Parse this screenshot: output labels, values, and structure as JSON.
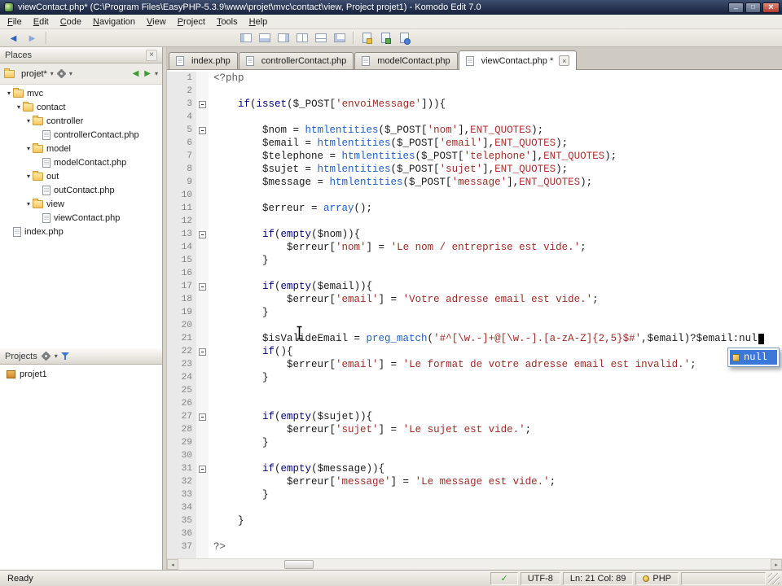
{
  "window": {
    "title": "viewContact.php* (C:\\Program Files\\EasyPHP-5.3.9\\www\\projet\\mvc\\contact\\view, Project projet1) - Komodo Edit 7.0"
  },
  "menubar": {
    "items": [
      "File",
      "Edit",
      "Code",
      "Navigation",
      "View",
      "Project",
      "Tools",
      "Help"
    ]
  },
  "toolbar": {
    "groups": [
      {
        "buttons": [
          {
            "name": "back-icon",
            "kind": "arrow-back"
          },
          {
            "name": "forward-icon",
            "kind": "arrow-forward"
          }
        ]
      },
      {
        "buttons": [
          {
            "name": "toggle-left-pane-icon",
            "kind": "pane-left"
          },
          {
            "name": "toggle-bottom-pane-icon",
            "kind": "pane-bottom"
          },
          {
            "name": "toggle-right-pane-icon",
            "kind": "pane-right"
          },
          {
            "name": "split-vertical-icon",
            "kind": "pane-vsplit"
          },
          {
            "name": "split-horizontal-icon",
            "kind": "pane-hsplit"
          },
          {
            "name": "show-all-panes-icon",
            "kind": "pane-all"
          }
        ]
      },
      {
        "buttons": [
          {
            "name": "open-file-icon",
            "kind": "doc-open"
          },
          {
            "name": "save-file-icon",
            "kind": "doc-save"
          },
          {
            "name": "preview-browser-icon",
            "kind": "doc-preview"
          }
        ]
      }
    ]
  },
  "places": {
    "title": "Places",
    "project_selector": "projet*",
    "tree": [
      {
        "label": "mvc",
        "type": "folder",
        "depth": 0
      },
      {
        "label": "contact",
        "type": "folder",
        "depth": 1
      },
      {
        "label": "controller",
        "type": "folder",
        "depth": 2
      },
      {
        "label": "controllerContact.php",
        "type": "file",
        "depth": 3
      },
      {
        "label": "model",
        "type": "folder",
        "depth": 2
      },
      {
        "label": "modelContact.php",
        "type": "file",
        "depth": 3
      },
      {
        "label": "out",
        "type": "folder",
        "depth": 2
      },
      {
        "label": "outContact.php",
        "type": "file",
        "depth": 3
      },
      {
        "label": "view",
        "type": "folder",
        "depth": 2
      },
      {
        "label": "viewContact.php",
        "type": "file",
        "depth": 3
      },
      {
        "label": "index.php",
        "type": "file",
        "depth": 0
      }
    ]
  },
  "projects": {
    "title": "Projects",
    "items": [
      {
        "label": "projet1"
      }
    ]
  },
  "tabs": [
    {
      "label": "index.php",
      "active": false
    },
    {
      "label": "controllerContact.php",
      "active": false
    },
    {
      "label": "modelContact.php",
      "active": false
    },
    {
      "label": "viewContact.php *",
      "active": true
    }
  ],
  "editor": {
    "caret_line": 21,
    "fold_lines": [
      3,
      5,
      13,
      17,
      22,
      27,
      31
    ],
    "completion": {
      "label": "null"
    },
    "lines": [
      [
        [
          "t",
          "<?php"
        ]
      ],
      [],
      [
        [
          "p",
          "    "
        ],
        [
          "k",
          "if"
        ],
        [
          "p",
          "("
        ],
        [
          "k",
          "isset"
        ],
        [
          "p",
          "($_POST["
        ],
        [
          "s",
          "'envoiMessage'"
        ],
        [
          "p",
          "])){"
        ]
      ],
      [],
      [
        [
          "p",
          "        $nom = "
        ],
        [
          "f",
          "htmlentities"
        ],
        [
          "p",
          "($_POST["
        ],
        [
          "s",
          "'nom'"
        ],
        [
          "p",
          "],"
        ],
        [
          "c",
          "ENT_QUOTES"
        ],
        [
          "p",
          ");"
        ]
      ],
      [
        [
          "p",
          "        $email = "
        ],
        [
          "f",
          "htmlentities"
        ],
        [
          "p",
          "($_POST["
        ],
        [
          "s",
          "'email'"
        ],
        [
          "p",
          "],"
        ],
        [
          "c",
          "ENT_QUOTES"
        ],
        [
          "p",
          ");"
        ]
      ],
      [
        [
          "p",
          "        $telephone = "
        ],
        [
          "f",
          "htmlentities"
        ],
        [
          "p",
          "($_POST["
        ],
        [
          "s",
          "'telephone'"
        ],
        [
          "p",
          "],"
        ],
        [
          "c",
          "ENT_QUOTES"
        ],
        [
          "p",
          ");"
        ]
      ],
      [
        [
          "p",
          "        $sujet = "
        ],
        [
          "f",
          "htmlentities"
        ],
        [
          "p",
          "($_POST["
        ],
        [
          "s",
          "'sujet'"
        ],
        [
          "p",
          "],"
        ],
        [
          "c",
          "ENT_QUOTES"
        ],
        [
          "p",
          ");"
        ]
      ],
      [
        [
          "p",
          "        $message = "
        ],
        [
          "f",
          "htmlentities"
        ],
        [
          "p",
          "($_POST["
        ],
        [
          "s",
          "'message'"
        ],
        [
          "p",
          "],"
        ],
        [
          "c",
          "ENT_QUOTES"
        ],
        [
          "p",
          ");"
        ]
      ],
      [],
      [
        [
          "p",
          "        $erreur = "
        ],
        [
          "f",
          "array"
        ],
        [
          "p",
          "();"
        ]
      ],
      [],
      [
        [
          "p",
          "        "
        ],
        [
          "k",
          "if"
        ],
        [
          "p",
          "("
        ],
        [
          "k",
          "empty"
        ],
        [
          "p",
          "($nom)){"
        ]
      ],
      [
        [
          "p",
          "            $erreur["
        ],
        [
          "s",
          "'nom'"
        ],
        [
          "p",
          "] = "
        ],
        [
          "s",
          "'Le nom / entreprise est vide.'"
        ],
        [
          "p",
          ";"
        ]
      ],
      [
        [
          "p",
          "        }"
        ]
      ],
      [],
      [
        [
          "p",
          "        "
        ],
        [
          "k",
          "if"
        ],
        [
          "p",
          "("
        ],
        [
          "k",
          "empty"
        ],
        [
          "p",
          "($email)){"
        ]
      ],
      [
        [
          "p",
          "            $erreur["
        ],
        [
          "s",
          "'email'"
        ],
        [
          "p",
          "] = "
        ],
        [
          "s",
          "'Votre adresse email est vide.'"
        ],
        [
          "p",
          ";"
        ]
      ],
      [
        [
          "p",
          "        }"
        ]
      ],
      [],
      [
        [
          "p",
          "        $isValideEmail = "
        ],
        [
          "f",
          "preg_match"
        ],
        [
          "p",
          "("
        ],
        [
          "s",
          "'#^[\\w.-]+@[\\w.-].[a-zA-Z]{2,5}$#'"
        ],
        [
          "p",
          ",$email)?$email:nul"
        ]
      ],
      [
        [
          "p",
          "        "
        ],
        [
          "k",
          "if"
        ],
        [
          "p",
          "(){"
        ]
      ],
      [
        [
          "p",
          "            $erreur["
        ],
        [
          "s",
          "'email'"
        ],
        [
          "p",
          "] = "
        ],
        [
          "s",
          "'Le format de votre adresse email est invalid.'"
        ],
        [
          "p",
          ";"
        ]
      ],
      [
        [
          "p",
          "        }"
        ]
      ],
      [],
      [],
      [
        [
          "p",
          "        "
        ],
        [
          "k",
          "if"
        ],
        [
          "p",
          "("
        ],
        [
          "k",
          "empty"
        ],
        [
          "p",
          "($sujet)){"
        ]
      ],
      [
        [
          "p",
          "            $erreur["
        ],
        [
          "s",
          "'sujet'"
        ],
        [
          "p",
          "] = "
        ],
        [
          "s",
          "'Le sujet est vide.'"
        ],
        [
          "p",
          ";"
        ]
      ],
      [
        [
          "p",
          "        }"
        ]
      ],
      [],
      [
        [
          "p",
          "        "
        ],
        [
          "k",
          "if"
        ],
        [
          "p",
          "("
        ],
        [
          "k",
          "empty"
        ],
        [
          "p",
          "($message)){"
        ]
      ],
      [
        [
          "p",
          "            $erreur["
        ],
        [
          "s",
          "'message'"
        ],
        [
          "p",
          "] = "
        ],
        [
          "s",
          "'Le message est vide.'"
        ],
        [
          "p",
          ";"
        ]
      ],
      [
        [
          "p",
          "        }"
        ]
      ],
      [],
      [
        [
          "p",
          "    }"
        ]
      ],
      [],
      [
        [
          "t",
          "?>"
        ]
      ]
    ]
  },
  "statusbar": {
    "status": "Ready",
    "encoding": "UTF-8",
    "position": "Ln: 21 Col: 89",
    "language": "PHP"
  },
  "colors": {
    "titlebar": "#16203a",
    "selection_blue": "#3c78d8",
    "keyword_blue": "#00007f",
    "function_blue": "#1f5fc4",
    "string_red": "#9e2b25",
    "folder_yellow": "#f3c65e"
  }
}
